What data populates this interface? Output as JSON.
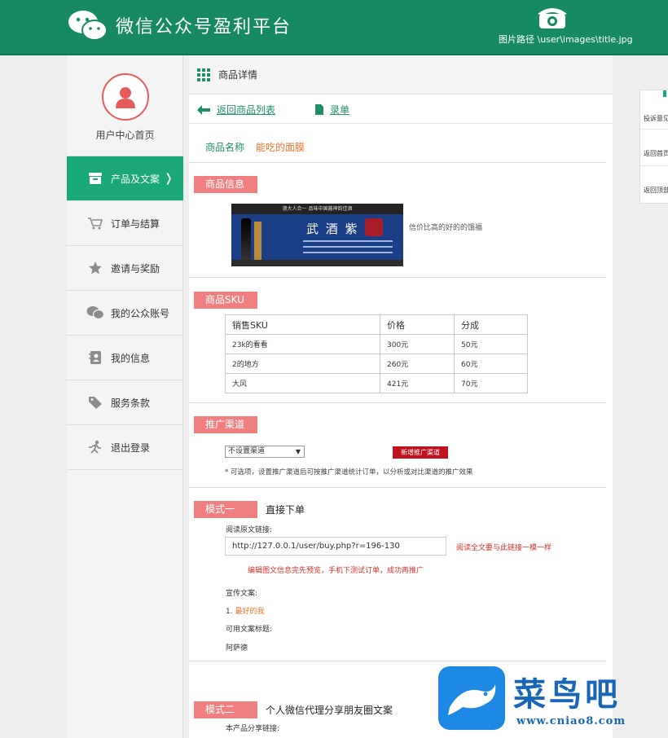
{
  "header": {
    "brand": "微信公众号盈利平台",
    "image_path_text": "图片路径 \\user\\images\\title.jpg"
  },
  "sidebar": {
    "user_label": "用户中心首页",
    "items": [
      {
        "label": "产品及文案",
        "icon": "box-icon",
        "active": true
      },
      {
        "label": "订单与结算",
        "icon": "cart-icon"
      },
      {
        "label": "邀请与奖励",
        "icon": "star-icon"
      },
      {
        "label": "我的公众账号",
        "icon": "wechat-icon"
      },
      {
        "label": "我的信息",
        "icon": "contact-icon"
      },
      {
        "label": "服务条款",
        "icon": "tag-icon"
      },
      {
        "label": "退出登录",
        "icon": "run-icon"
      }
    ],
    "active_arrow": "❭"
  },
  "main": {
    "breadcrumb": "商品详情",
    "back_link": "返回商品列表",
    "record_link": "录单",
    "product_name_label": "商品名称",
    "product_name_value": "能吃的面膜",
    "section_info": "商品信息",
    "banner": {
      "top_text": "澳大人合一  品味中国酱神韵佳酒",
      "title": "武 酒 紫 雪"
    },
    "product_desc": "信价比高的好的的饿福",
    "section_sku": "商品SKU",
    "sku_table": {
      "headers": [
        "销售SKU",
        "价格",
        "分成"
      ],
      "rows": [
        [
          "23k的看看",
          "300元",
          "50元"
        ],
        [
          "2的地方",
          "260元",
          "60元"
        ],
        [
          "大风",
          "421元",
          "70元"
        ]
      ]
    },
    "section_channel": "推广渠道",
    "channel_select": "不设置渠道",
    "new_channel_button": "新增推广渠道",
    "channel_note": "* 可选项，设置推广渠道后可按推广渠道统计订单，以分析或对比渠道的推广效果",
    "mode1_tag": "模式一",
    "mode1_title": "直接下单",
    "read_link_label": "阅读原文链接:",
    "read_link_value": "http://127.0.0.1/user/buy.php?r=196-130",
    "read_link_note": "阅读全文要与此链接一模一样",
    "preview_note": "编辑图文信息完先预览，手机下测试订单，成功再推广",
    "copy_label": "宣传文案:",
    "copy_index": "1.",
    "copy_value": "最好的我",
    "title_label": "可用文案标题:",
    "title_value": "阿萨德",
    "mode2_tag": "模式二",
    "mode2_title": "个人微信代理分享朋友圈文案",
    "share_link_label": "本产品分享链接:"
  },
  "float_panel": {
    "items": [
      "投诉意见",
      "返回首页",
      "返回顶部"
    ]
  },
  "watermark": {
    "text": "菜鸟吧",
    "url": "www.cniao8.com"
  }
}
